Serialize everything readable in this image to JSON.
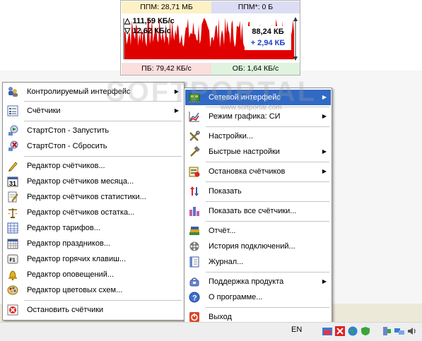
{
  "widget": {
    "ppm": "ППМ: 28,71 МБ",
    "ppm_star": "ППМ*: 0 Б",
    "download": "△ 111,59 КБ/с",
    "upload": "▽ 12,62 КБ/с",
    "box_total": "88,24 КБ",
    "box_delta": "+ 2,94 КБ",
    "pb": "ПБ: 79,42 КБ/с",
    "ob": "ОБ: 1,64 КБ/с",
    "graph_color": "#e00000"
  },
  "menu_left": {
    "items": [
      {
        "label": "Контролируемый интерфейс",
        "icon": "network-users-icon",
        "submenu": true
      },
      {
        "label": "Счётчики",
        "icon": "counters-list-icon",
        "submenu": true
      },
      {
        "label": "СтартСтоп - Запустить",
        "icon": "start-icon"
      },
      {
        "label": "СтартСтоп - Сбросить",
        "icon": "reset-icon"
      },
      {
        "label": "Редактор счётчиков...",
        "icon": "pencil-icon"
      },
      {
        "label": "Редактор счётчиков месяца...",
        "icon": "calendar-31-icon"
      },
      {
        "label": "Редактор счётчиков статистики...",
        "icon": "notepad-icon"
      },
      {
        "label": "Редактор счётчиков остатка...",
        "icon": "scales-icon"
      },
      {
        "label": "Редактор тарифов...",
        "icon": "grid-table-icon"
      },
      {
        "label": "Редактор праздников...",
        "icon": "calendar-grid-icon"
      },
      {
        "label": "Редактор горячих клавиш...",
        "icon": "f1-key-icon"
      },
      {
        "label": "Редактор оповещений...",
        "icon": "bell-icon"
      },
      {
        "label": "Редактор цветовых схем...",
        "icon": "palette-icon"
      },
      {
        "label": "Остановить счётчики",
        "icon": "stop-icon"
      }
    ]
  },
  "menu_right": {
    "items": [
      {
        "label": "Сетевой интерфейс",
        "icon": "network-card-icon",
        "submenu": true
      },
      {
        "label": "Режим графика: СИ",
        "icon": "chart-mode-icon",
        "submenu": true
      },
      {
        "label": "Настройки...",
        "icon": "tools-icon"
      },
      {
        "label": "Быстрые настройки",
        "icon": "hammer-icon",
        "submenu": true
      },
      {
        "label": "Остановка счётчиков",
        "icon": "stop-counters-icon",
        "submenu": true
      },
      {
        "label": "Показать",
        "icon": "show-arrows-icon"
      },
      {
        "label": "Показать все счётчики...",
        "icon": "bar-chart-icon"
      },
      {
        "label": "Отчёт...",
        "icon": "books-icon"
      },
      {
        "label": "История подключений...",
        "icon": "film-reel-icon"
      },
      {
        "label": "Журнал...",
        "icon": "journal-icon"
      },
      {
        "label": "Поддержка продукта",
        "icon": "support-icon",
        "submenu": true
      },
      {
        "label": "О программе...",
        "icon": "help-icon"
      },
      {
        "label": "Выход",
        "icon": "exit-icon"
      }
    ]
  },
  "taskbar": {
    "language": "EN"
  },
  "watermark": {
    "big": "SOFTPORTAL",
    "small": "www.softportal.com"
  }
}
